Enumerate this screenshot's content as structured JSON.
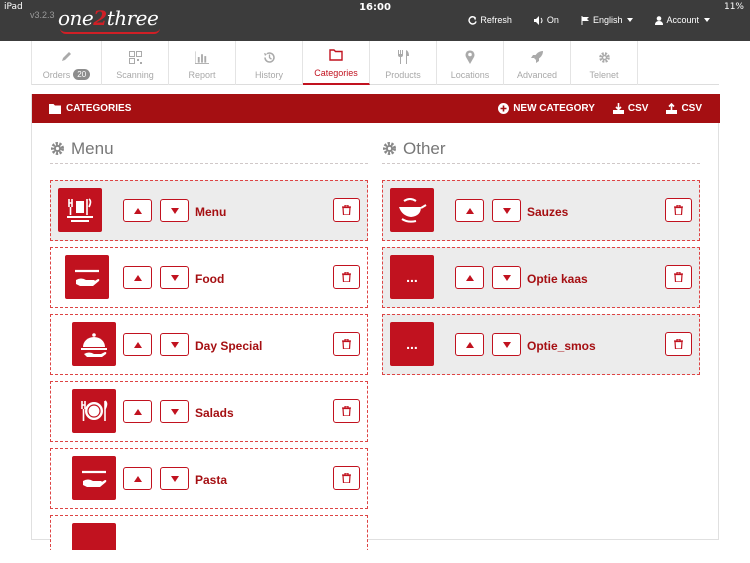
{
  "status": {
    "device": "iPad",
    "time": "16:00",
    "battery": "11%"
  },
  "app": {
    "version": "v3.2.3",
    "logo_a": "one",
    "logo_b": "2",
    "logo_c": "three"
  },
  "topnav": {
    "refresh": "Refresh",
    "sound": "On",
    "language": "English",
    "account": "Account"
  },
  "tabs": [
    {
      "label": "Orders",
      "badge": "20",
      "icon": "pencil-icon"
    },
    {
      "label": "Scanning",
      "icon": "qr-code-icon"
    },
    {
      "label": "Report",
      "icon": "bar-chart-icon"
    },
    {
      "label": "History",
      "icon": "history-icon"
    },
    {
      "label": "Categories",
      "icon": "folder-icon",
      "active": true
    },
    {
      "label": "Products",
      "icon": "cutlery-icon"
    },
    {
      "label": "Locations",
      "icon": "map-pin-icon"
    },
    {
      "label": "Advanced",
      "icon": "rocket-icon"
    },
    {
      "label": "Telenet",
      "icon": "gear-icon"
    }
  ],
  "panel": {
    "title": "CATEGORIES",
    "new_category": "NEW CATEGORY",
    "csv_download": "CSV",
    "csv_upload": "CSV"
  },
  "columns": {
    "menu": {
      "title": "Menu",
      "items": [
        {
          "name": "Menu",
          "icon": "meal-tray-icon"
        },
        {
          "name": "Food",
          "icon": "serving-hand-icon"
        },
        {
          "name": "Day Special",
          "icon": "cloche-icon"
        },
        {
          "name": "Salads",
          "icon": "plate-cutlery-icon"
        },
        {
          "name": "Pasta",
          "icon": "serving-hand-icon"
        }
      ]
    },
    "other": {
      "title": "Other",
      "items": [
        {
          "name": "Sauzes",
          "icon": "sauce-boat-icon"
        },
        {
          "name": "Optie kaas",
          "icon": "ellipsis-icon",
          "glyph": "..."
        },
        {
          "name": "Optie_smos",
          "icon": "ellipsis-icon",
          "glyph": "..."
        }
      ]
    }
  },
  "colors": {
    "brand": "#c1121f",
    "header": "#a50f12",
    "topbar": "#3c3c3c"
  }
}
